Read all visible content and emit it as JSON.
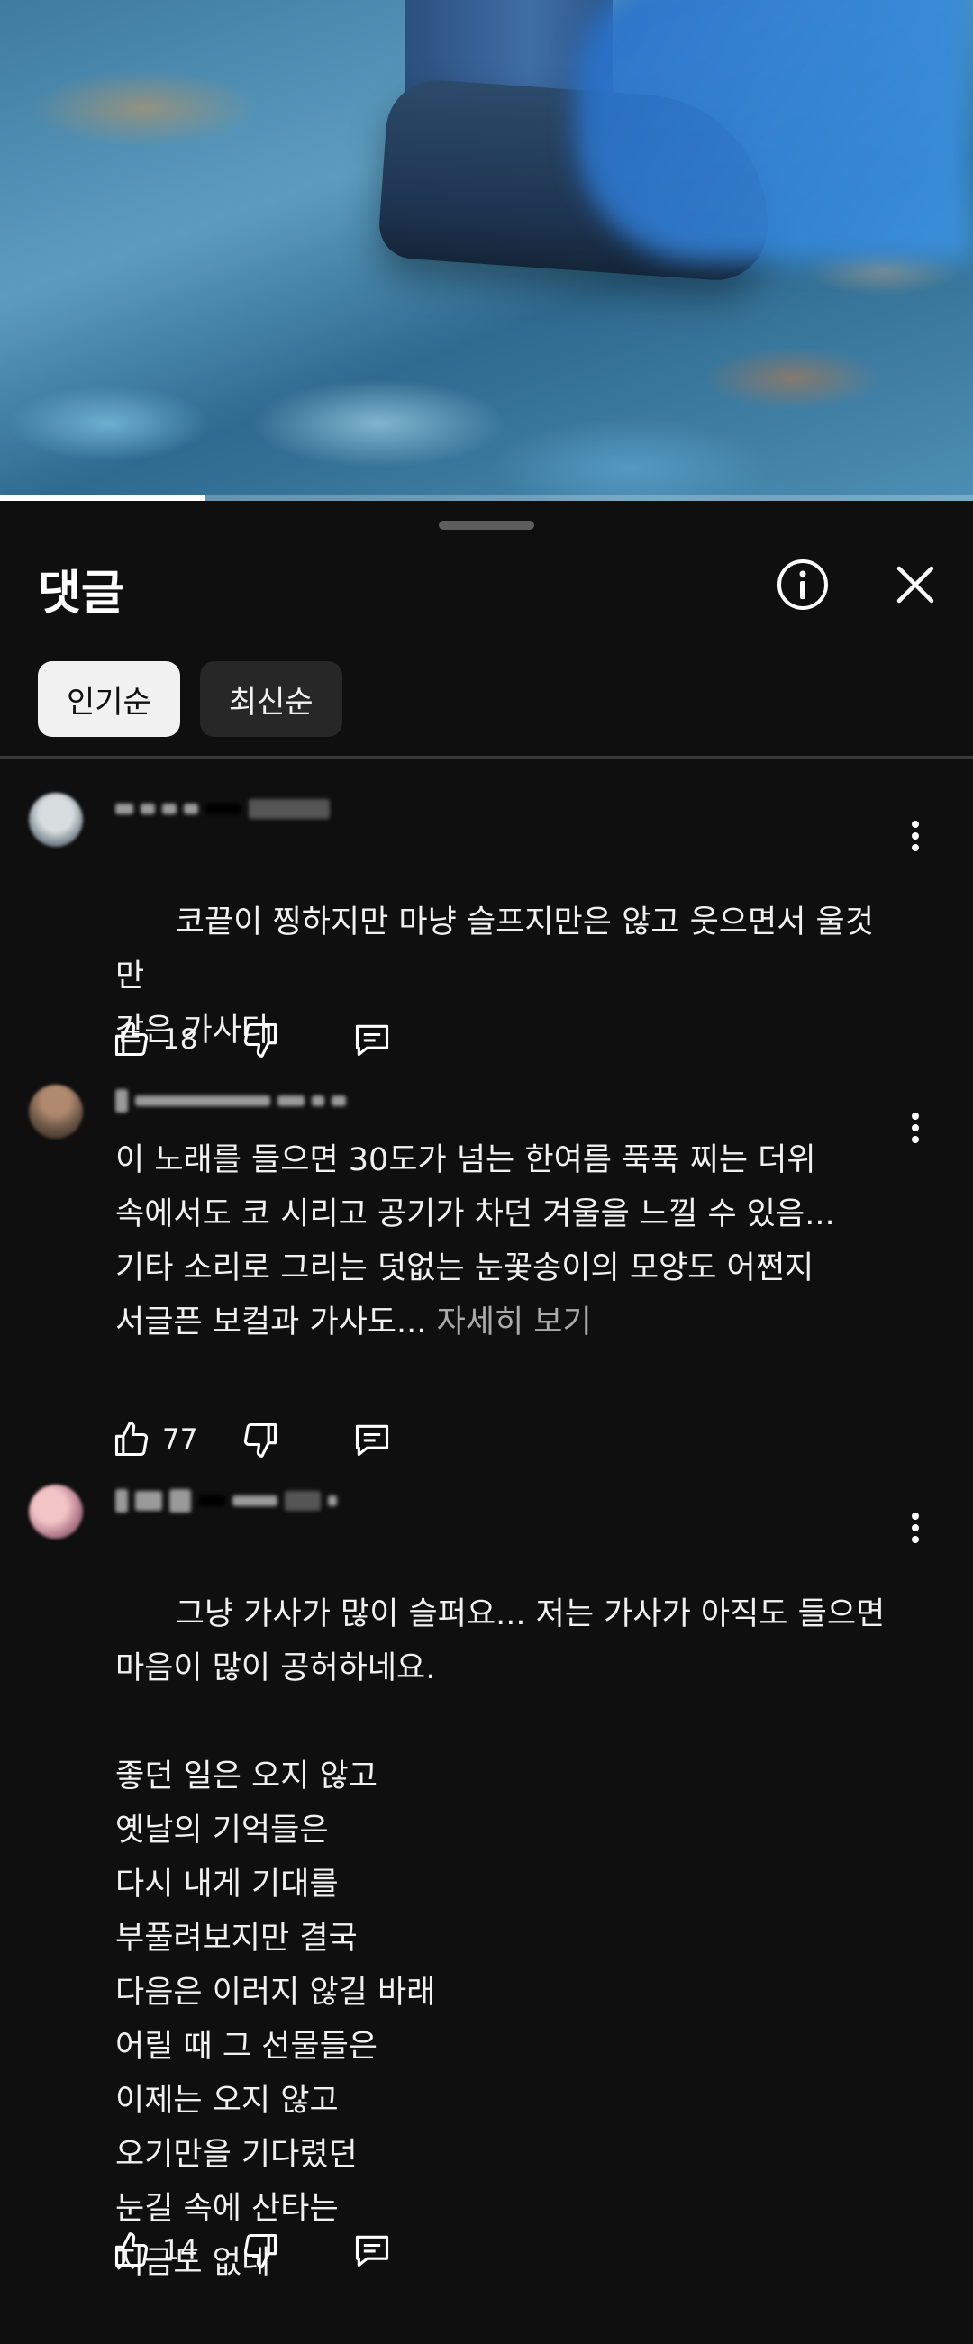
{
  "player": {
    "progress_fraction": 0.21
  },
  "sheet": {
    "title": "댓글",
    "sort_chips": [
      {
        "label": "인기순",
        "active": true
      },
      {
        "label": "최신순",
        "active": false
      }
    ]
  },
  "comments": [
    {
      "text": "코끝이 찡하지만 마냥 슬프지만은 않고 웃으면서 울것만\n같은 가사다",
      "more": "",
      "likes": "18"
    },
    {
      "text": "이 노래를 들으면 30도가 넘는 한여름 푹푹 찌는 더위\n속에서도 코 시리고 공기가 차던 겨울을 느낄 수 있음...\n기타 소리로 그리는 덧없는 눈꽃송이의 모양도 어쩐지\n서글픈 보컬과 가사도... ",
      "more": "자세히 보기",
      "likes": "77"
    },
    {
      "text": "그냥 가사가 많이 슬퍼요... 저는 가사가 아직도 들으면\n마음이 많이 공허하네요.\n\n좋던 일은 오지 않고\n옛날의 기억들은\n다시 내게 기대를\n부풀려보지만 결국\n다음은 이러지 않길 바래\n어릴 때 그 선물들은\n이제는 오지 않고\n오기만을 기다렸던\n눈길 속에 산타는\n지금도 없네",
      "more": "",
      "likes": "14"
    }
  ]
}
